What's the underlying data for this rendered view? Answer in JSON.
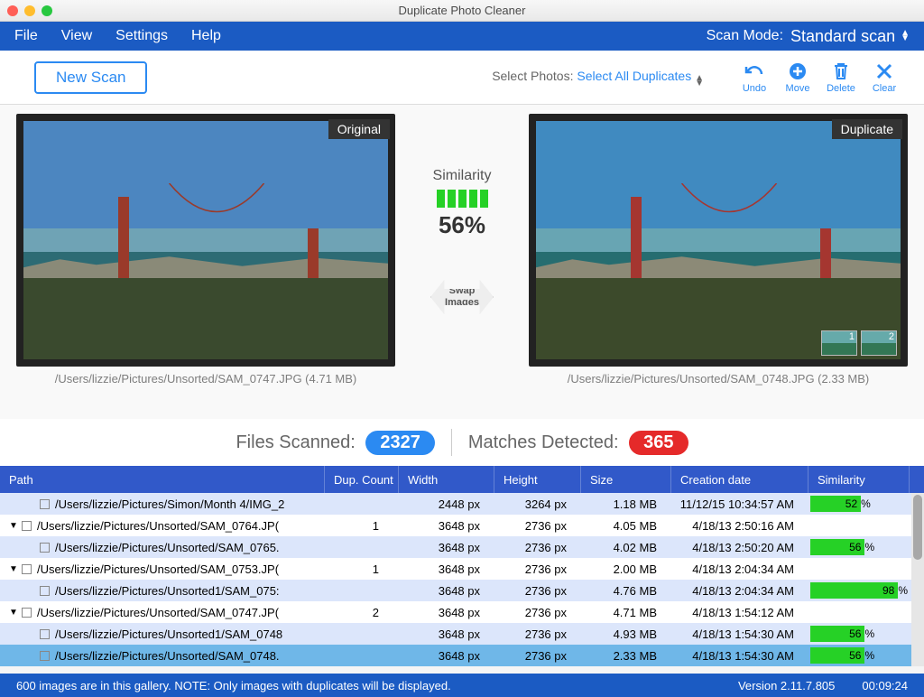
{
  "window": {
    "title": "Duplicate Photo Cleaner"
  },
  "menu": {
    "file": "File",
    "view": "View",
    "settings": "Settings",
    "help": "Help",
    "scanmode_label": "Scan Mode:",
    "scanmode_value": "Standard scan"
  },
  "toolbar": {
    "newscan": "New Scan",
    "select_label": "Select Photos:",
    "select_link": "Select All Duplicates",
    "actions": {
      "undo": "Undo",
      "move": "Move",
      "delete": "Delete",
      "clear": "Clear"
    }
  },
  "preview": {
    "left": {
      "badge": "Original",
      "path": "/Users/lizzie/Pictures/Unsorted/SAM_0747.JPG (4.71 MB)"
    },
    "right": {
      "badge": "Duplicate",
      "path": "/Users/lizzie/Pictures/Unsorted/SAM_0748.JPG (2.33 MB)",
      "thumb1": "1",
      "thumb2": "2"
    },
    "similarity_label": "Similarity",
    "similarity_pct": "56%",
    "swap_line1": "Swap",
    "swap_line2": "Images"
  },
  "stats": {
    "scanned_label": "Files Scanned:",
    "scanned_value": "2327",
    "matches_label": "Matches Detected:",
    "matches_value": "365"
  },
  "table": {
    "headers": {
      "path": "Path",
      "dup": "Dup. Count",
      "w": "Width",
      "h": "Height",
      "size": "Size",
      "date": "Creation date",
      "sim": "Similarity"
    },
    "rows": [
      {
        "indent": true,
        "path": "/Users/lizzie/Pictures/Simon/Month 4/IMG_2",
        "dup": "",
        "w": "2448 px",
        "h": "3264 px",
        "size": "1.18 MB",
        "date": "11/12/15 10:34:57 AM",
        "sim": "52",
        "bg": "light"
      },
      {
        "parent": true,
        "path": "/Users/lizzie/Pictures/Unsorted/SAM_0764.JP(",
        "dup": "1",
        "w": "3648 px",
        "h": "2736 px",
        "size": "4.05 MB",
        "date": "4/18/13 2:50:16 AM",
        "sim": "",
        "bg": "white"
      },
      {
        "indent": true,
        "path": "/Users/lizzie/Pictures/Unsorted/SAM_0765.",
        "dup": "",
        "w": "3648 px",
        "h": "2736 px",
        "size": "4.02 MB",
        "date": "4/18/13 2:50:20 AM",
        "sim": "56",
        "bg": "light"
      },
      {
        "parent": true,
        "path": "/Users/lizzie/Pictures/Unsorted/SAM_0753.JP(",
        "dup": "1",
        "w": "3648 px",
        "h": "2736 px",
        "size": "2.00 MB",
        "date": "4/18/13 2:04:34 AM",
        "sim": "",
        "bg": "white"
      },
      {
        "indent": true,
        "path": "/Users/lizzie/Pictures/Unsorted1/SAM_075:",
        "dup": "",
        "w": "3648 px",
        "h": "2736 px",
        "size": "4.76 MB",
        "date": "4/18/13 2:04:34 AM",
        "sim": "98",
        "bg": "light"
      },
      {
        "parent": true,
        "path": "/Users/lizzie/Pictures/Unsorted/SAM_0747.JP(",
        "dup": "2",
        "w": "3648 px",
        "h": "2736 px",
        "size": "4.71 MB",
        "date": "4/18/13 1:54:12 AM",
        "sim": "",
        "bg": "white"
      },
      {
        "indent": true,
        "path": "/Users/lizzie/Pictures/Unsorted1/SAM_0748",
        "dup": "",
        "w": "3648 px",
        "h": "2736 px",
        "size": "4.93 MB",
        "date": "4/18/13 1:54:30 AM",
        "sim": "56",
        "bg": "light"
      },
      {
        "indent": true,
        "path": "/Users/lizzie/Pictures/Unsorted/SAM_0748.",
        "dup": "",
        "w": "3648 px",
        "h": "2736 px",
        "size": "2.33 MB",
        "date": "4/18/13 1:54:30 AM",
        "sim": "56",
        "bg": "selected"
      }
    ]
  },
  "status": {
    "msg": "600 images are in this gallery. NOTE: Only images with duplicates will be displayed.",
    "version": "Version 2.11.7.805",
    "time": "00:09:24"
  }
}
